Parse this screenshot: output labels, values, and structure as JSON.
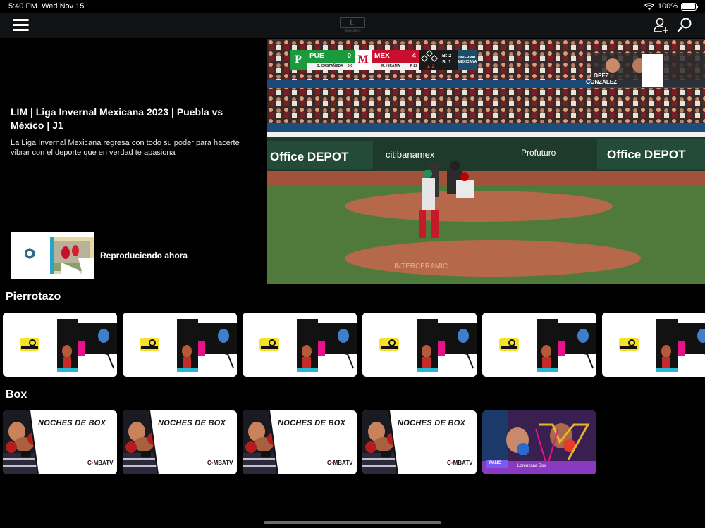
{
  "status": {
    "time": "5:40 PM",
    "date": "Wed Nov 15",
    "battery": "100%",
    "battery_level": 1.0,
    "icons": [
      "wifi-icon",
      "battery-icon"
    ]
  },
  "header": {
    "logo_mark": "L",
    "logo_sub": "deportes",
    "icons": [
      "menu-icon",
      "user-add-icon",
      "search-icon"
    ]
  },
  "hero": {
    "title": "LIM | Liga Invernal Mexicana 2023 | Puebla  vs México  | J1",
    "description": "La Liga Invernal Mexicana regresa con todo su poder para hacerte vibrar con el deporte que en verdad te apasiona",
    "now_playing": "Reproduciendo ahora"
  },
  "video": {
    "scoreboard": {
      "home_logo": "P",
      "home_abbr": "PUE",
      "home_score": "0",
      "home_player": "G. CASTAÑEDA",
      "home_player_stat": "0-0",
      "away_logo": "M",
      "away_abbr": "MEX",
      "away_score": "4",
      "away_player": "R. HIRAMA",
      "away_player_stat": "P 22",
      "inning": "▲ 2",
      "balls": "B: 2",
      "strikes": "S: 1",
      "brand": "INVERNAL MEXICANA"
    },
    "banners": {
      "office_left": "Office DEPOT",
      "office_right": "Office DEPOT",
      "citibanamex": "citibanamex",
      "profuturo": "Profuturo",
      "intercramic": "INTERCERAMIC"
    },
    "fighters": {
      "name1": "LOPEZ",
      "name2": "GONZALEZ"
    }
  },
  "sections": {
    "pierrotazo": {
      "title": "Pierrotazo",
      "card_logo": "EL PIERROTAZO",
      "count": 6
    },
    "box": {
      "title": "Box",
      "card_title": "NOCHES DE BOX",
      "card_brand_pre": "C",
      "card_brand_mid": "•",
      "card_brand_post": "MBATV",
      "last_card": "Lorenzana Box",
      "last_card_badge": "PANC"
    }
  },
  "colors": {
    "background": "#000000",
    "top_bar": "#111214",
    "pue_green": "#1a9a3c",
    "mex_red": "#c8102e",
    "accent_pink": "#e8118c",
    "accent_cyan": "#26b7d6"
  }
}
